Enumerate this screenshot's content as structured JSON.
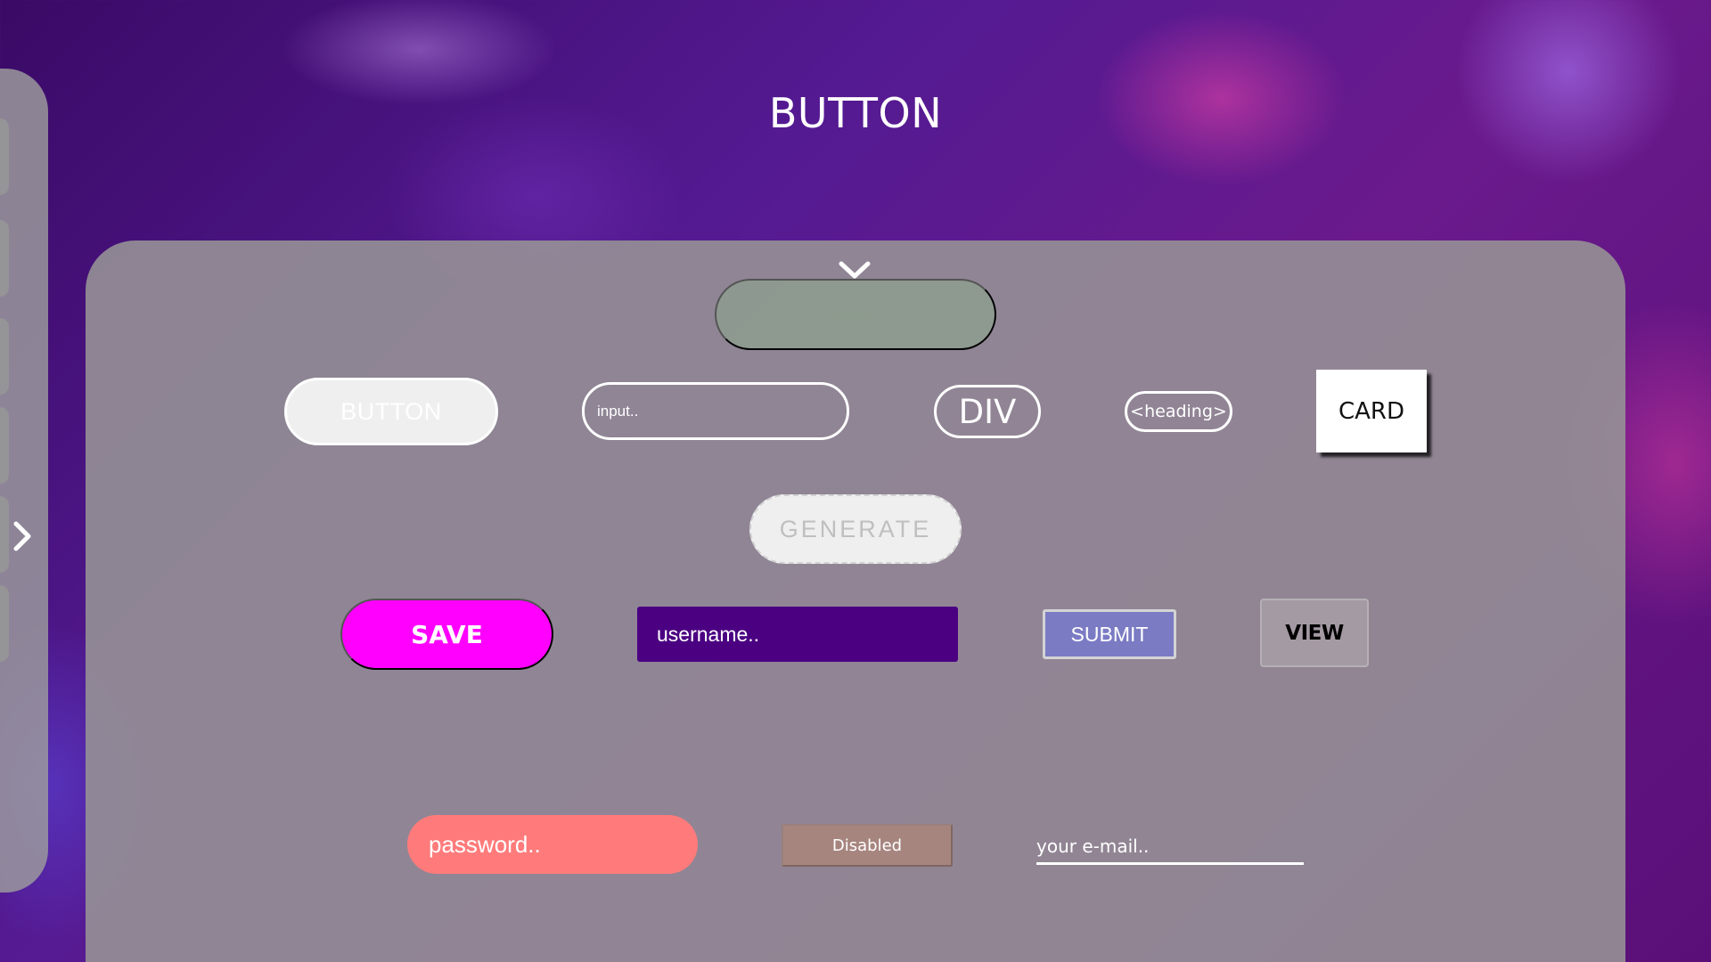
{
  "page": {
    "title": "BUTTON"
  },
  "sidebar": {
    "toggle_icon": "chevron-right-icon"
  },
  "panel": {
    "collapse_icon": "chevron-down-icon",
    "row1": {
      "ghost_button_label": "button",
      "outline_button_label": "BUTTON",
      "input_placeholder": "input..",
      "div_label": "DIV",
      "heading_label": "<heading>",
      "card_label": "CARD"
    },
    "row2": {
      "generate_label": "GENERATE"
    },
    "row3": {
      "save_label": "SAVE",
      "username_placeholder": "username..",
      "submit_label": "SUBMIT",
      "view_label": "VIEW"
    },
    "row4": {
      "password_placeholder": "password..",
      "disabled_label": "Disabled",
      "email_placeholder": "your e-mail.."
    }
  },
  "colors": {
    "save_button": "#ff00ff",
    "username_input": "#4b0082",
    "submit_button": "#7b7bc4",
    "password_input": "#ff7b7b",
    "disabled_button": "#a7857f",
    "card_background": "#ffffff"
  }
}
